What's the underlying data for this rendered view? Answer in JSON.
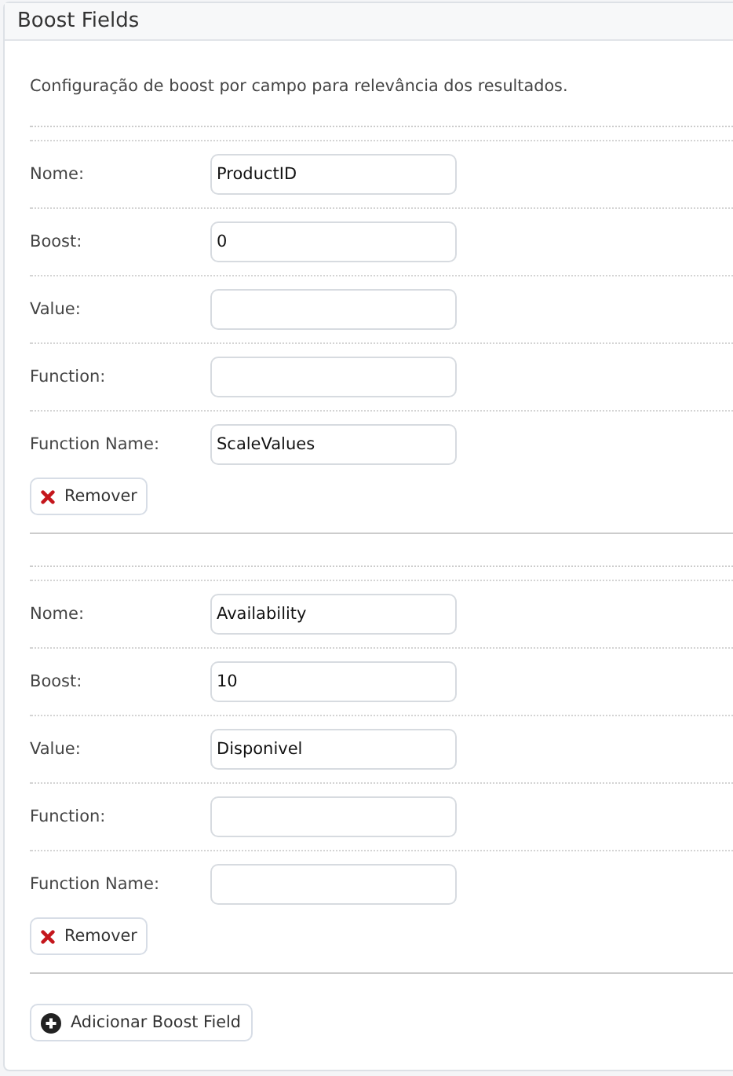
{
  "panel": {
    "title": "Boost Fields",
    "description": "Configuração de boost por campo para relevância dos resultados."
  },
  "groups": [
    {
      "fields": [
        {
          "label": "Nome:",
          "value": "ProductID"
        },
        {
          "label": "Boost:",
          "value": "0"
        },
        {
          "label": "Value:"
        },
        {
          "label": "Function:"
        },
        {
          "label": "Function Name:",
          "value": "ScaleValues"
        }
      ],
      "remove_button": "Remover"
    },
    {
      "fields": [
        {
          "label": "Nome:",
          "value": "Availability"
        },
        {
          "label": "Boost:",
          "value": "10"
        },
        {
          "label": "Value:",
          "value": "Disponivel"
        },
        {
          "label": "Function:"
        },
        {
          "label": "Function Name:"
        }
      ],
      "remove_button": "Remover"
    }
  ],
  "add_button": "Adicionar Boost Field"
}
